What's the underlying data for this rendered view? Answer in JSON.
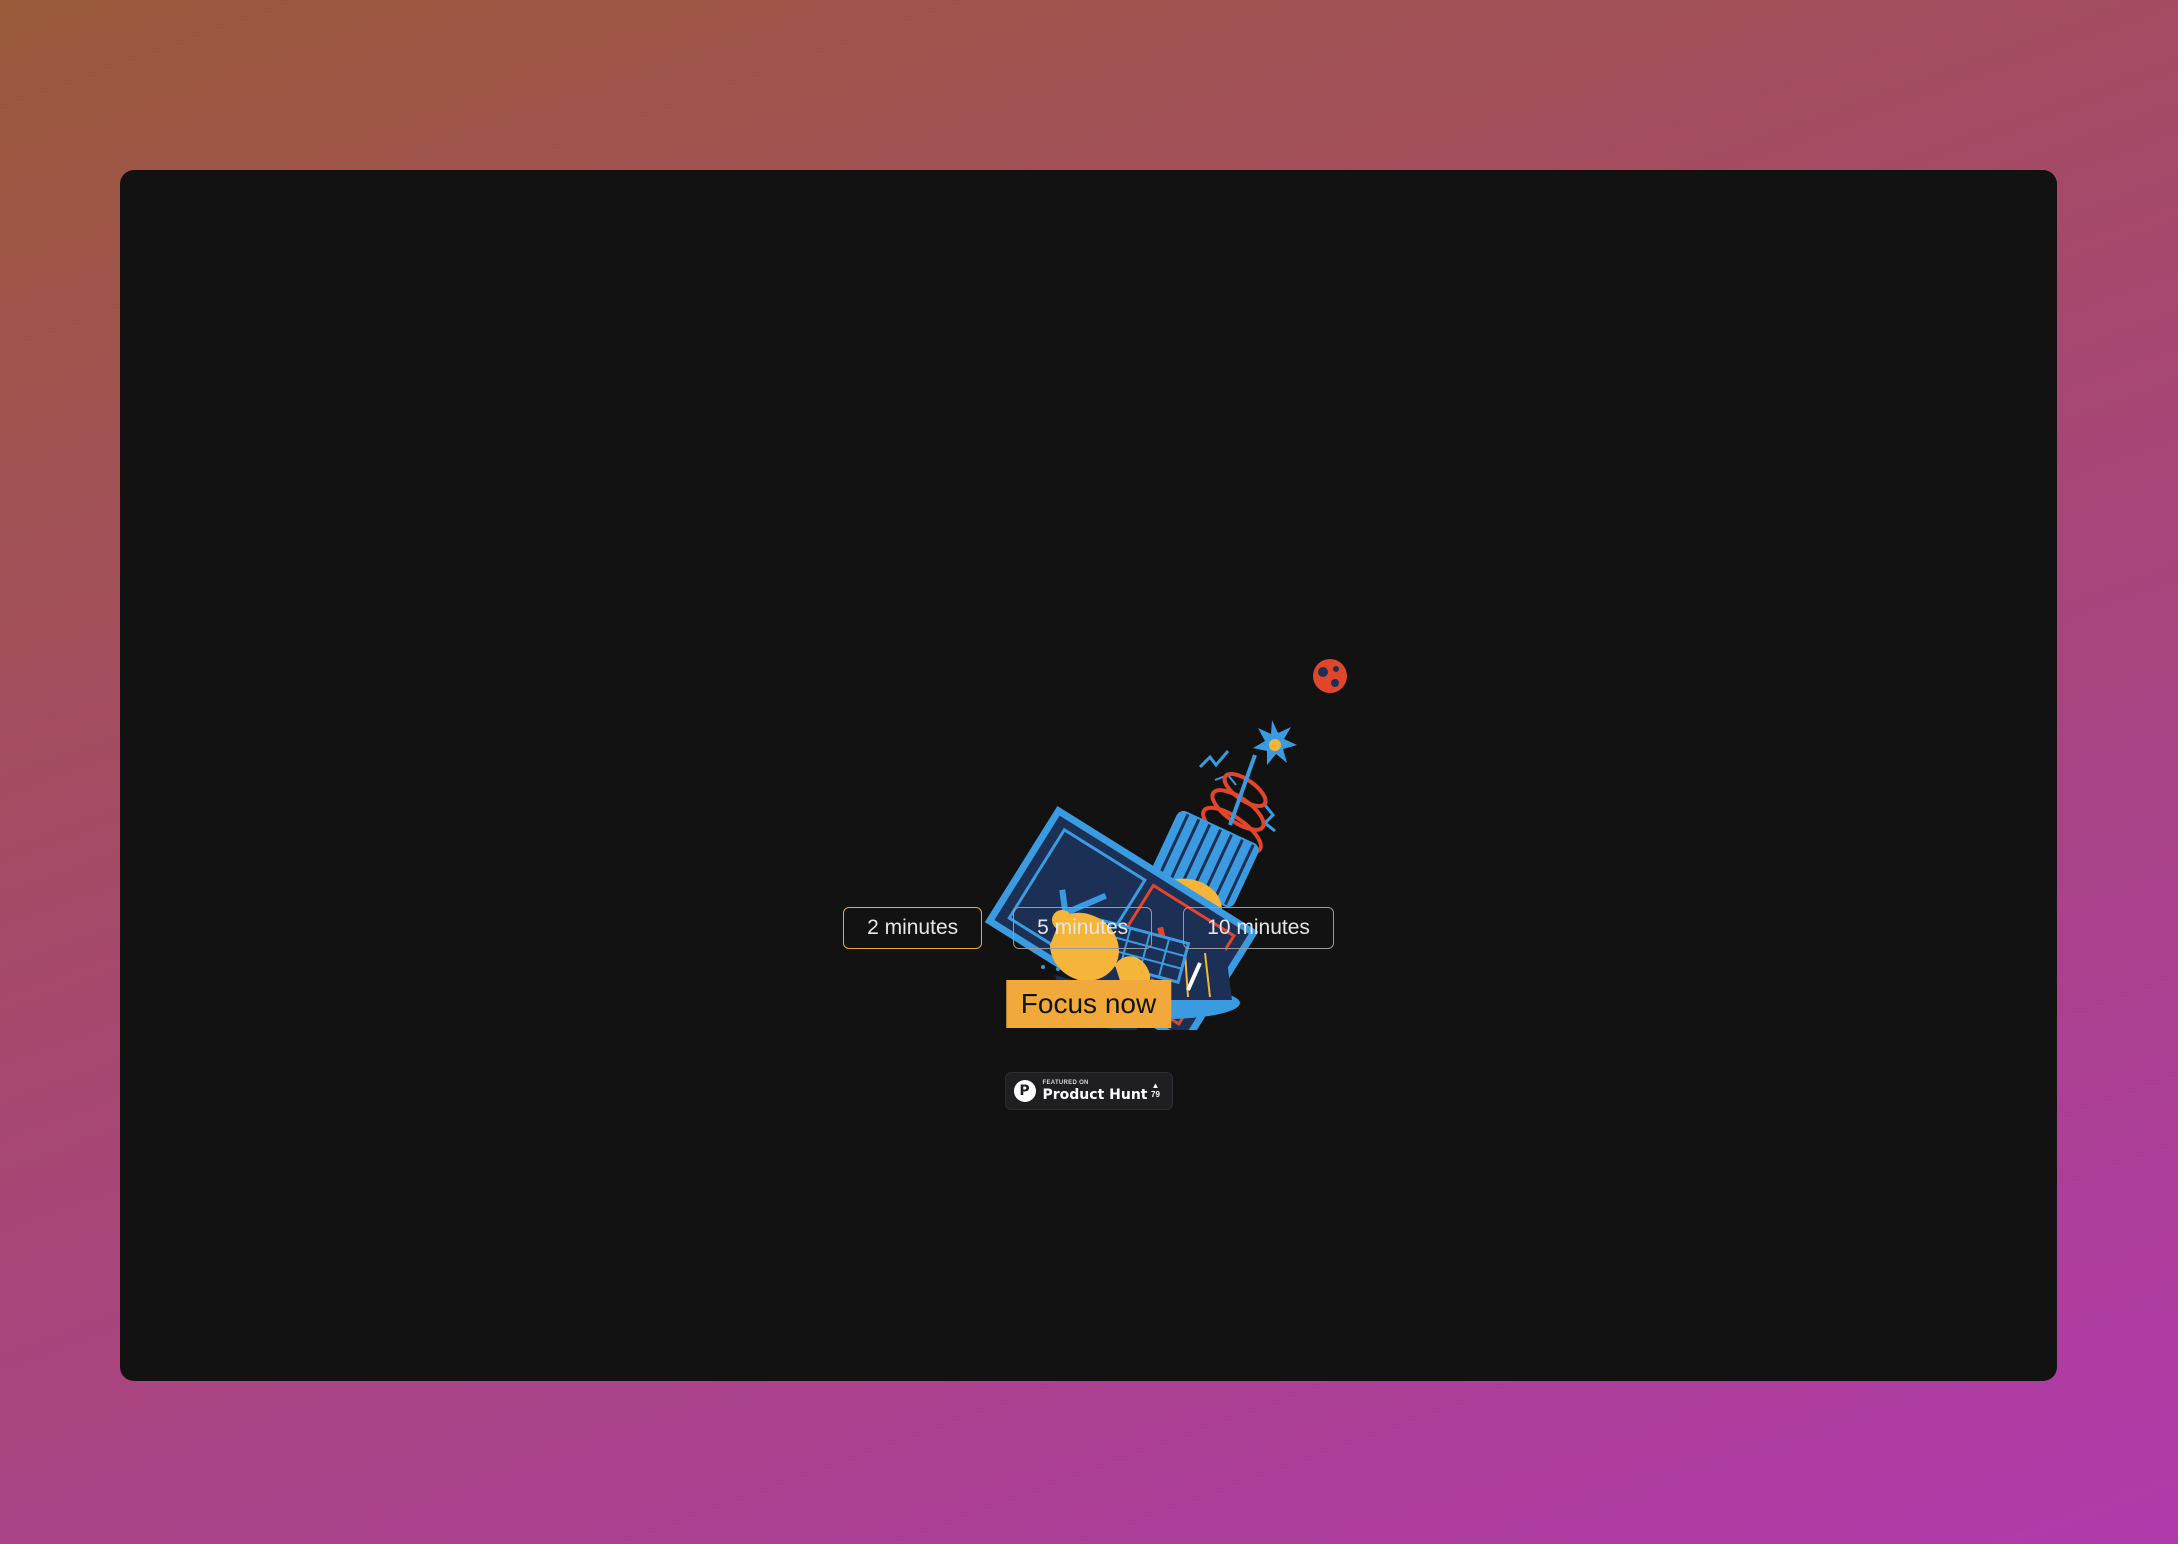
{
  "durations": {
    "options": [
      {
        "label": "2 minutes",
        "selected": true
      },
      {
        "label": "5 minutes",
        "selected": false
      },
      {
        "label": "10 minutes",
        "selected": false
      }
    ]
  },
  "focus_button": {
    "label": "Focus now"
  },
  "product_hunt_badge": {
    "featured_text": "FEATURED ON",
    "name": "Product Hunt",
    "upvote_icon": "triangle-up-icon",
    "votes": "79"
  },
  "illustration": {
    "description_icon": "rocket-laptop-illustration"
  },
  "colors": {
    "background_gradient_start": "#9b5a3a",
    "background_gradient_end": "#b03aac",
    "window_bg": "#121212",
    "accent": "#f0a93a",
    "illustration_blue": "#3b9be0",
    "illustration_red": "#e0462c",
    "illustration_yellow": "#f4b53a",
    "illustration_navy": "#1c2f55"
  }
}
